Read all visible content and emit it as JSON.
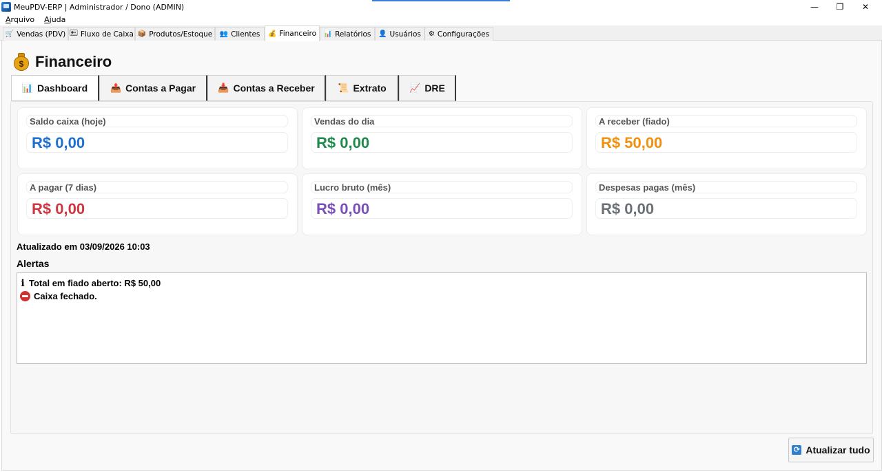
{
  "window": {
    "title": "MeuPDV-ERP  |  Administrador / Dono (ADMIN)",
    "controls": {
      "minimize": "—",
      "maximize": "❐",
      "close": "✕"
    }
  },
  "menu": {
    "items": [
      {
        "label_u": "A",
        "label_rest": "rquivo"
      },
      {
        "label_u": "A",
        "label_rest": "juda"
      }
    ]
  },
  "main_tabs": [
    {
      "icon": "🛒",
      "label": "Vendas (PDV)",
      "active": false
    },
    {
      "icon": "🖭",
      "label": "Fluxo de Caixa",
      "active": false
    },
    {
      "icon": "📦",
      "label": "Produtos/Estoque",
      "active": false
    },
    {
      "icon": "👥",
      "label": "Clientes",
      "active": false
    },
    {
      "icon": "💰",
      "label": "Financeiro",
      "active": true
    },
    {
      "icon": "📊",
      "label": "Relatórios",
      "active": false
    },
    {
      "icon": "👤",
      "label": "Usuários",
      "active": false
    },
    {
      "icon": "⚙",
      "label": "Configurações",
      "active": false
    }
  ],
  "page": {
    "title": "Financeiro",
    "money_sign": "$"
  },
  "sub_tabs": [
    {
      "icon": "📊",
      "label": "Dashboard",
      "active": true
    },
    {
      "icon": "📤",
      "label": "Contas a Pagar",
      "active": false
    },
    {
      "icon": "📥",
      "label": "Contas a Receber",
      "active": false
    },
    {
      "icon": "📜",
      "label": "Extrato",
      "active": false
    },
    {
      "icon": "📈",
      "label": "DRE",
      "active": false
    }
  ],
  "cards": [
    {
      "label": "Saldo caixa (hoje)",
      "value": "R$ 0,00",
      "color": "#1f6fd1"
    },
    {
      "label": "Vendas do dia",
      "value": "R$ 0,00",
      "color": "#1f8a4c"
    },
    {
      "label": "A receber (fiado)",
      "value": "R$ 50,00",
      "color": "#f0900e"
    },
    {
      "label": "A pagar (7 dias)",
      "value": "R$ 0,00",
      "color": "#d0363f"
    },
    {
      "label": "Lucro bruto (mês)",
      "value": "R$ 0,00",
      "color": "#7b4fb8"
    },
    {
      "label": "Despesas pagas (mês)",
      "value": "R$ 0,00",
      "color": "#6b7177"
    }
  ],
  "updated": "Atualizado em 03/09/2026 10:03",
  "alerts": {
    "title": "Alertas",
    "items": [
      {
        "type": "info",
        "glyph": "i",
        "text": "Total em fiado aberto: R$ 50,00"
      },
      {
        "type": "error",
        "glyph": "",
        "text": "Caixa fechado."
      }
    ]
  },
  "refresh_button": {
    "icon": "🔄",
    "label": "Atualizar tudo"
  }
}
